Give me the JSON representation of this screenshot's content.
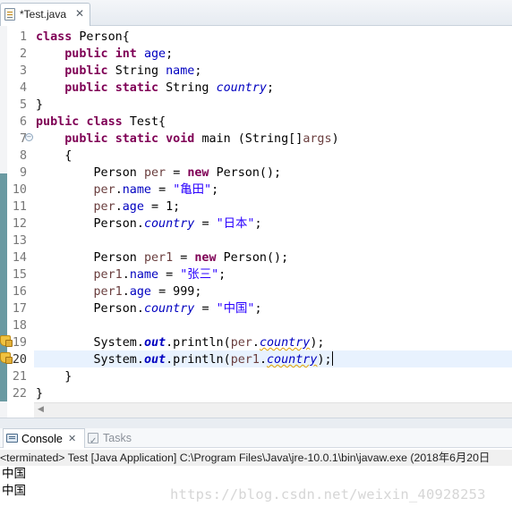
{
  "editor_tab": {
    "title": "*Test.java",
    "close_glyph": "✕",
    "file_icon": "java-file-icon"
  },
  "code_lines": [
    {
      "num": "1",
      "segs": [
        [
          "kw",
          "class"
        ],
        [
          "",
          "Person{"
        ]
      ]
    },
    {
      "num": "2",
      "segs": [
        [
          "",
          "    "
        ],
        [
          "kw",
          "public"
        ],
        [
          "",
          ""
        ],
        [
          "kw",
          "int"
        ],
        [
          "fld",
          "age"
        ],
        [
          "",
          ";"
        ]
      ]
    },
    {
      "num": "3",
      "segs": [
        [
          "",
          "    "
        ],
        [
          "kw",
          "public"
        ],
        [
          "",
          "String"
        ],
        [
          "fld",
          "name"
        ],
        [
          "",
          ";"
        ]
      ]
    },
    {
      "num": "4",
      "segs": [
        [
          "",
          "    "
        ],
        [
          "kw",
          "public"
        ],
        [
          "kw",
          "static"
        ],
        [
          "",
          "String"
        ],
        [
          "sfld",
          "country"
        ],
        [
          "",
          ";"
        ]
      ]
    },
    {
      "num": "5",
      "segs": [
        [
          "",
          "}"
        ]
      ]
    },
    {
      "num": "6",
      "segs": [
        [
          "kw",
          "public"
        ],
        [
          "kw",
          "class"
        ],
        [
          "",
          "Test{"
        ]
      ]
    },
    {
      "num": "7",
      "segs": [
        [
          "",
          "    "
        ],
        [
          "kw",
          "public"
        ],
        [
          "kw",
          "static"
        ],
        [
          "kw",
          "void"
        ],
        [
          "",
          "main (String[]"
        ],
        [
          "loc",
          "args"
        ],
        [
          "",
          ")"
        ]
      ]
    },
    {
      "num": "8",
      "segs": [
        [
          "",
          "    {"
        ]
      ]
    },
    {
      "num": "9",
      "segs": [
        [
          "",
          "        Person"
        ],
        [
          "loc",
          "per"
        ],
        [
          "",
          "="
        ],
        [
          "kw",
          "new"
        ],
        [
          "",
          "Person();"
        ]
      ]
    },
    {
      "num": "10",
      "segs": [
        [
          "",
          "        "
        ],
        [
          "loc",
          "per"
        ],
        [
          "",
          "."
        ],
        [
          "fld",
          "name"
        ],
        [
          "",
          ""
        ],
        [
          "",
          "="
        ],
        [
          "str",
          "\"亀田\""
        ],
        [
          "",
          ";"
        ]
      ]
    },
    {
      "num": "11",
      "segs": [
        [
          "",
          "        "
        ],
        [
          "loc",
          "per"
        ],
        [
          "",
          "."
        ],
        [
          "fld",
          "age"
        ],
        [
          "",
          ""
        ],
        [
          "",
          "= 1;"
        ]
      ]
    },
    {
      "num": "12",
      "segs": [
        [
          "",
          "        Person."
        ],
        [
          "sfld",
          "country"
        ],
        [
          "",
          ""
        ],
        [
          "",
          "="
        ],
        [
          "str",
          "\"日本\""
        ],
        [
          "",
          ";"
        ]
      ]
    },
    {
      "num": "13",
      "segs": []
    },
    {
      "num": "14",
      "segs": [
        [
          "",
          "        Person"
        ],
        [
          "loc",
          "per1"
        ],
        [
          "",
          "="
        ],
        [
          "kw",
          "new"
        ],
        [
          "",
          "Person();"
        ]
      ]
    },
    {
      "num": "15",
      "segs": [
        [
          "",
          "        "
        ],
        [
          "loc",
          "per1"
        ],
        [
          "",
          "."
        ],
        [
          "fld",
          "name"
        ],
        [
          "",
          ""
        ],
        [
          "",
          "="
        ],
        [
          "str",
          "\"张三\""
        ],
        [
          "",
          ";"
        ]
      ]
    },
    {
      "num": "16",
      "segs": [
        [
          "",
          "        "
        ],
        [
          "loc",
          "per1"
        ],
        [
          "",
          "."
        ],
        [
          "fld",
          "age"
        ],
        [
          "",
          ""
        ],
        [
          "",
          "= 999;"
        ]
      ]
    },
    {
      "num": "17",
      "segs": [
        [
          "",
          "        Person."
        ],
        [
          "sfld",
          "country"
        ],
        [
          "",
          ""
        ],
        [
          "",
          "="
        ],
        [
          "str",
          "\"中国\""
        ],
        [
          "",
          ";"
        ]
      ]
    },
    {
      "num": "18",
      "segs": []
    },
    {
      "num": "19",
      "segs": [
        [
          "",
          "        System."
        ],
        [
          "sfldb",
          "out"
        ],
        [
          "",
          ".println("
        ],
        [
          "loc",
          "per"
        ],
        [
          "",
          "."
        ],
        [
          "sfldsq",
          "country"
        ],
        [
          "",
          ");"
        ]
      ]
    },
    {
      "num": "20",
      "segs": [
        [
          "",
          "        System."
        ],
        [
          "sfldb",
          "out"
        ],
        [
          "",
          ".println("
        ],
        [
          "loc",
          "per1"
        ],
        [
          "",
          "."
        ],
        [
          "sfldsq",
          "country"
        ],
        [
          "",
          ");"
        ]
      ]
    },
    {
      "num": "21",
      "segs": [
        [
          "",
          "    }"
        ]
      ]
    },
    {
      "num": "22",
      "segs": [
        [
          "",
          "}"
        ]
      ]
    }
  ],
  "active_line": "20",
  "console": {
    "tabs": [
      {
        "label": "Console",
        "close_glyph": "✕",
        "icon": "console-icon",
        "active": true
      },
      {
        "label": "Tasks",
        "icon": "tasks-icon",
        "active": false
      }
    ],
    "terminated_line": "<terminated> Test [Java Application] C:\\Program Files\\Java\\jre-10.0.1\\bin\\javaw.exe (2018年6月20日",
    "output": [
      "中国",
      "中国"
    ]
  },
  "watermark": "https://blog.csdn.net/weixin_40928253",
  "colors": {
    "keyword": "#7f0055",
    "field": "#0000c0",
    "string": "#2a00ff",
    "local_variable": "#6a3e3e",
    "current_line": "#e8f2fe"
  }
}
